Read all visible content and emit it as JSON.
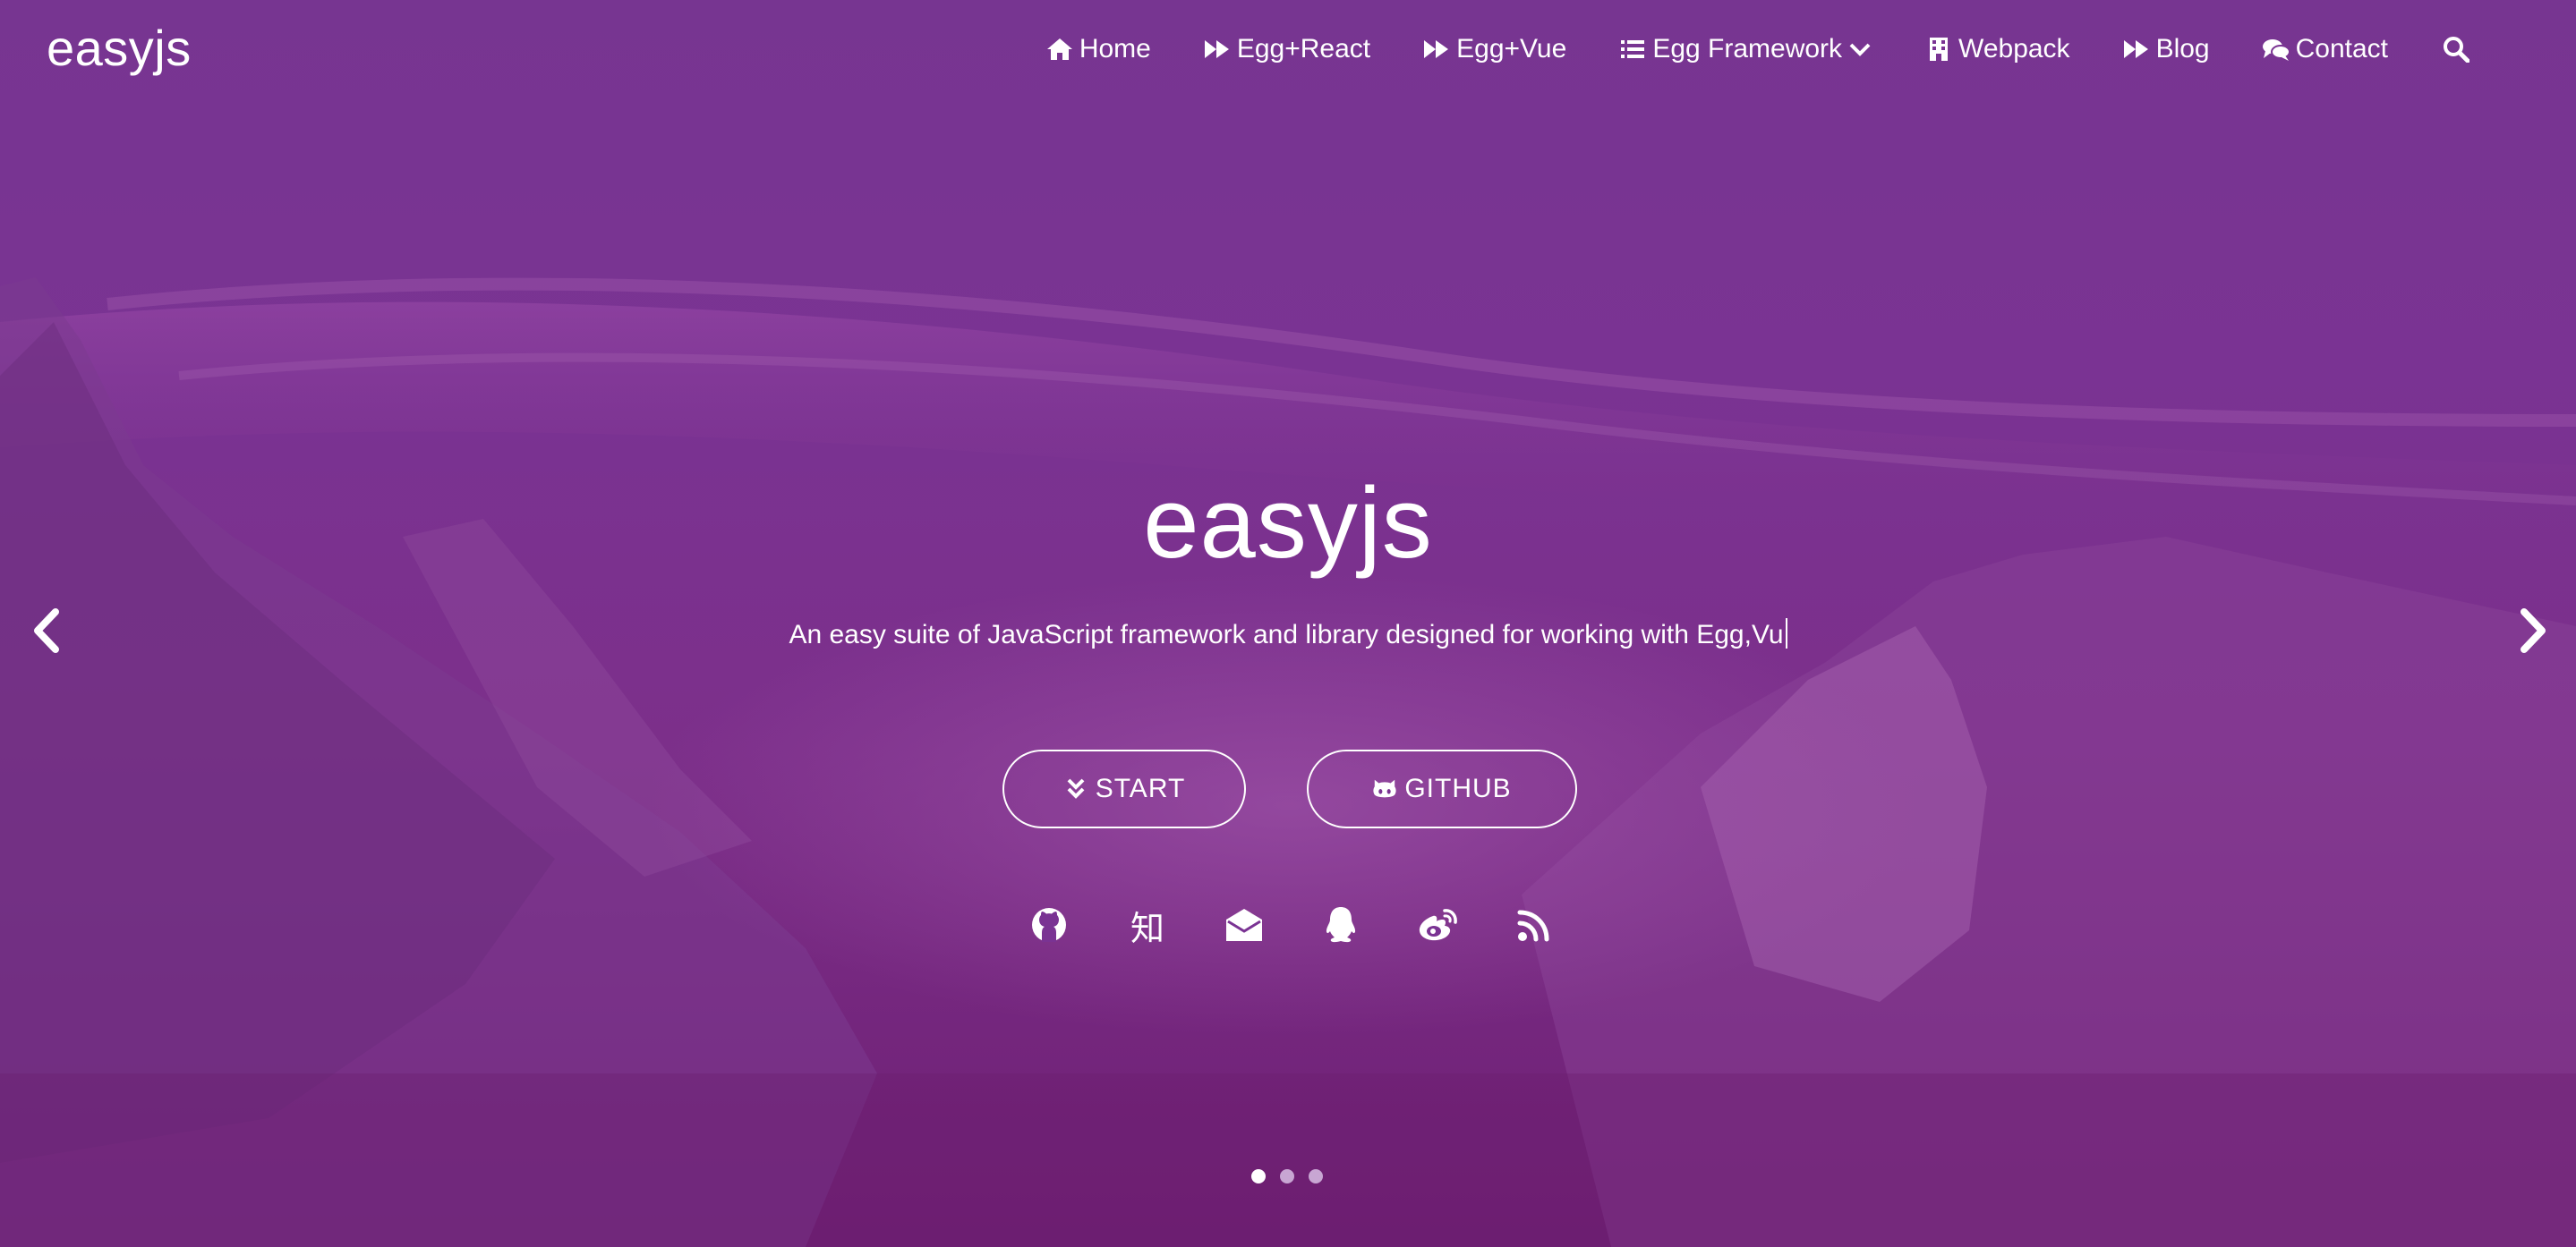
{
  "brand": {
    "name": "easyjs"
  },
  "nav": {
    "items": [
      {
        "label": "Home",
        "icon": "home-icon"
      },
      {
        "label": "Egg+React",
        "icon": "fast-forward-icon"
      },
      {
        "label": "Egg+Vue",
        "icon": "fast-forward-icon"
      },
      {
        "label": "Egg Framework",
        "icon": "list-icon",
        "dropdown": true
      },
      {
        "label": "Webpack",
        "icon": "building-icon"
      },
      {
        "label": "Blog",
        "icon": "fast-forward-icon"
      },
      {
        "label": "Contact",
        "icon": "comments-icon"
      }
    ],
    "search_icon": "search-icon"
  },
  "hero": {
    "title": "easyjs",
    "subtitle": "An easy suite of JavaScript framework and library designed for working with Egg,Vu",
    "start_label": "START",
    "github_label": "GITHUB",
    "socials": [
      {
        "name": "github-icon",
        "glyph": ""
      },
      {
        "name": "zhihu-icon",
        "glyph": "知"
      },
      {
        "name": "email-icon",
        "glyph": ""
      },
      {
        "name": "qq-icon",
        "glyph": ""
      },
      {
        "name": "weibo-icon",
        "glyph": ""
      },
      {
        "name": "rss-icon",
        "glyph": ""
      }
    ]
  },
  "carousel": {
    "slide_count": 3,
    "active_slide": 1
  },
  "colors": {
    "background_top": "#773591",
    "background_bottom": "#6e1f73",
    "text": "#ffffff",
    "dot_inactive": "#c8a6d3"
  }
}
